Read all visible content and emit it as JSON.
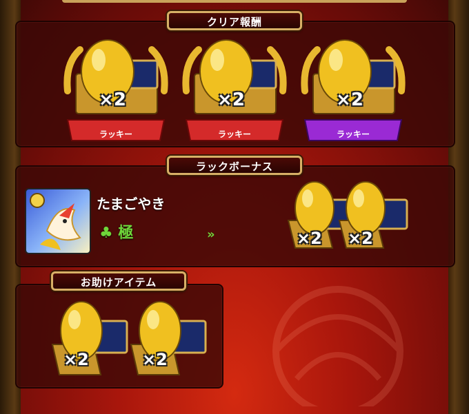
{
  "clear_reward": {
    "title": "クリア報酬",
    "items": [
      {
        "multiplier": "×2",
        "badge": "ラッキー",
        "badge_color": "#d42a2a"
      },
      {
        "multiplier": "×2",
        "badge": "ラッキー",
        "badge_color": "#d42a2a"
      },
      {
        "multiplier": "×2",
        "badge": "ラッキー",
        "badge_color": "#9a2ad4"
      }
    ]
  },
  "luck_bonus": {
    "title": "ラックボーナス",
    "monster_name": "たまごやき",
    "luck_icon": "clover-icon",
    "luck_rank": "極",
    "arrow": "»",
    "items": [
      {
        "multiplier": "×2"
      },
      {
        "multiplier": "×2"
      }
    ]
  },
  "helper_items": {
    "title": "お助けアイテム",
    "items": [
      {
        "multiplier": "×2"
      },
      {
        "multiplier": "×2"
      }
    ]
  }
}
